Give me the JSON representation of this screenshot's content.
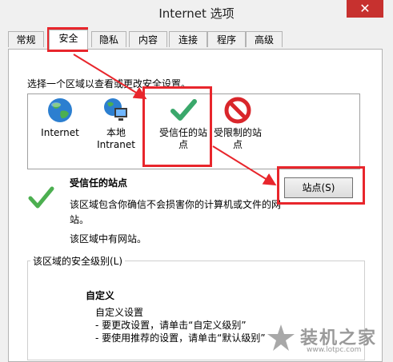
{
  "window": {
    "title": "Internet 选项",
    "close_symbol": "✕"
  },
  "tabs": [
    {
      "label": "常规"
    },
    {
      "label": "安全",
      "active": true
    },
    {
      "label": "隐私"
    },
    {
      "label": "内容"
    },
    {
      "label": "连接"
    },
    {
      "label": "程序"
    },
    {
      "label": "高级"
    }
  ],
  "security": {
    "zone_prompt": "选择一个区域以查看或更改安全设置。",
    "zones": [
      {
        "label": "Internet",
        "icon": "globe-icon"
      },
      {
        "label": "本地\nIntranet",
        "icon": "intranet-icon"
      },
      {
        "label": "受信任的站\n点",
        "icon": "checkmark-icon",
        "selected": true
      },
      {
        "label": "受限制的站\n点",
        "icon": "no-entry-icon"
      }
    ],
    "detail": {
      "title": "受信任的站点",
      "description": "该区域包含你确信不会损害你的计算机或文件的网站。",
      "note": "该区域中有网站。",
      "sites_button": "站点(S)"
    },
    "level_group": {
      "label": "该区域的安全级别(L)",
      "level_title": "自定义",
      "lines": [
        "自定义设置",
        "- 要更改设置，请单击“自定义级别”",
        "- 要使用推荐的设置，请单击“默认级别”"
      ]
    }
  },
  "watermark": {
    "text": "装机之家",
    "url": "www.lotpc.com"
  },
  "colors": {
    "annotation_red": "#e8262c",
    "selected_blue": "#3399ff",
    "close_red": "#c7312f"
  }
}
